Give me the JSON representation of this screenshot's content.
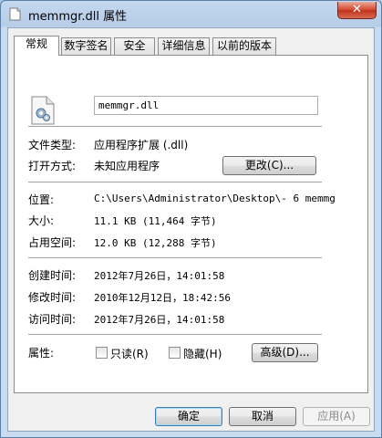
{
  "window": {
    "title": "memmgr.dll 属性",
    "close_label": "✕"
  },
  "tabs": [
    {
      "label": "常规",
      "active": true
    },
    {
      "label": "数字签名"
    },
    {
      "label": "安全"
    },
    {
      "label": "详细信息"
    },
    {
      "label": "以前的版本"
    }
  ],
  "general": {
    "filename": "memmgr.dll",
    "file_type_label": "文件类型:",
    "file_type_value": "应用程序扩展 (.dll)",
    "opens_with_label": "打开方式:",
    "opens_with_value": "未知应用程序",
    "change_button": "更改(C)...",
    "location_label": "位置:",
    "location_value": "C:\\Users\\Administrator\\Desktop\\-  6 memmg",
    "size_label": "大小:",
    "size_value": "11.1 KB (11,464 字节)",
    "size_on_disk_label": "占用空间:",
    "size_on_disk_value": "12.0 KB (12,288 字节)",
    "created_label": "创建时间:",
    "created_value": "2012年7月26日，14:01:58",
    "modified_label": "修改时间:",
    "modified_value": "2010年12月12日，18:42:56",
    "accessed_label": "访问时间:",
    "accessed_value": "2012年7月26日，14:01:58",
    "attributes_label": "属性:",
    "readonly_label": "只读(R)",
    "hidden_label": "隐藏(H)",
    "advanced_button": "高级(D)..."
  },
  "footer": {
    "ok_button": "确定",
    "cancel_button": "取消",
    "apply_button": "应用(A)"
  }
}
